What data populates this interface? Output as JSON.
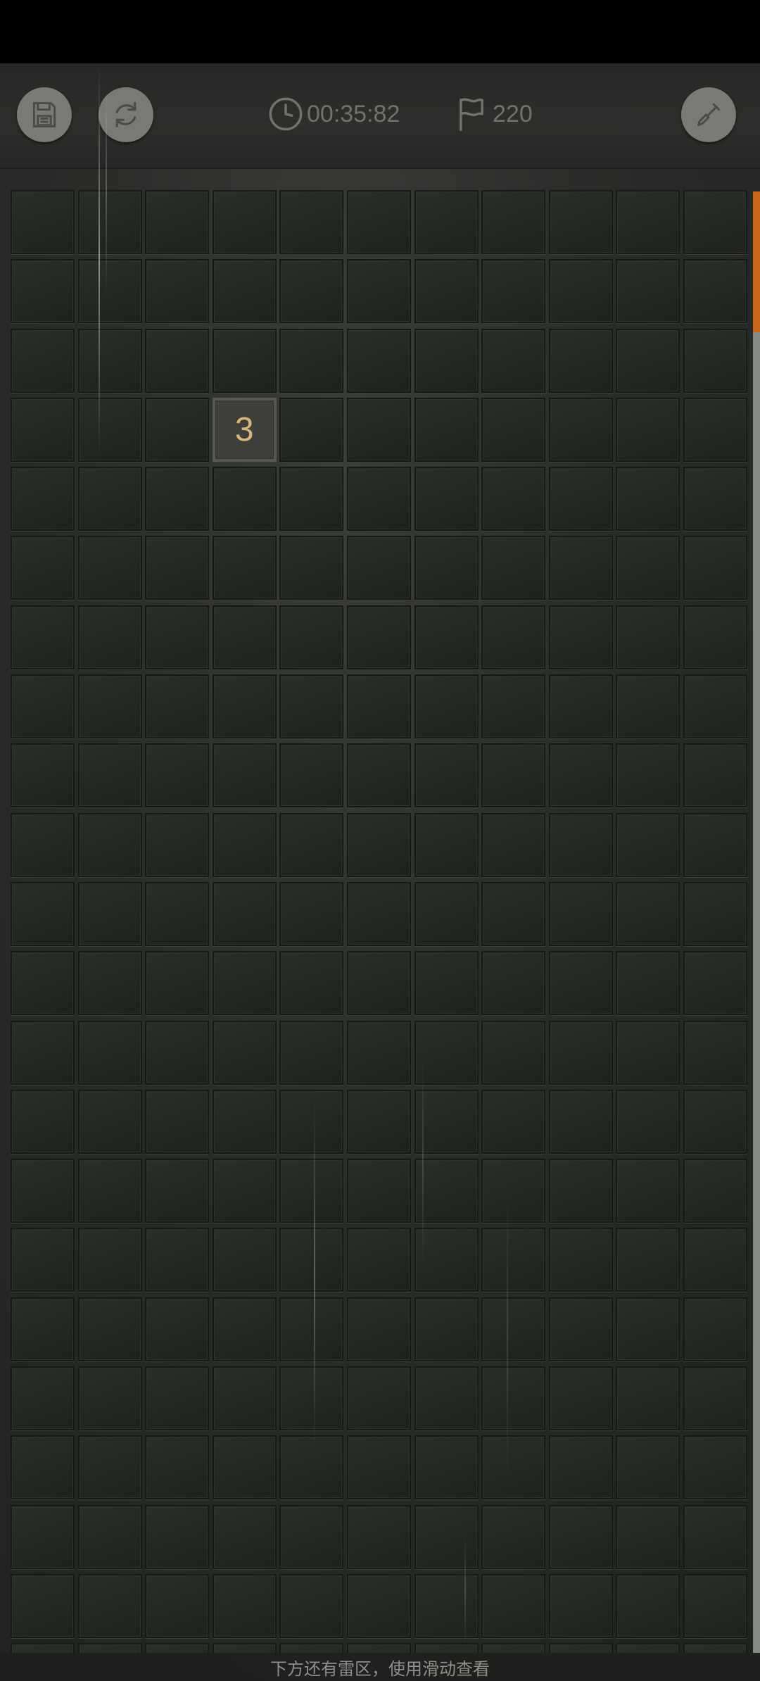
{
  "toolbar": {
    "timer_text": "00:35:82",
    "flag_count": "220",
    "icons": {
      "save": "save-floppy-icon",
      "restart": "restart-icon",
      "timer": "clock-icon",
      "flags": "flag-icon",
      "tool": "shovel-icon"
    }
  },
  "board": {
    "columns": 11,
    "visible_rows": 22,
    "revealed_cells": [
      {
        "row": 4,
        "col": 4,
        "value": "3"
      }
    ]
  },
  "hint": {
    "text": "下方还有雷区，使用滑动查看"
  },
  "colors": {
    "accent_scroll_thumb": "#c8641c",
    "number_color": "#d9b57e"
  }
}
